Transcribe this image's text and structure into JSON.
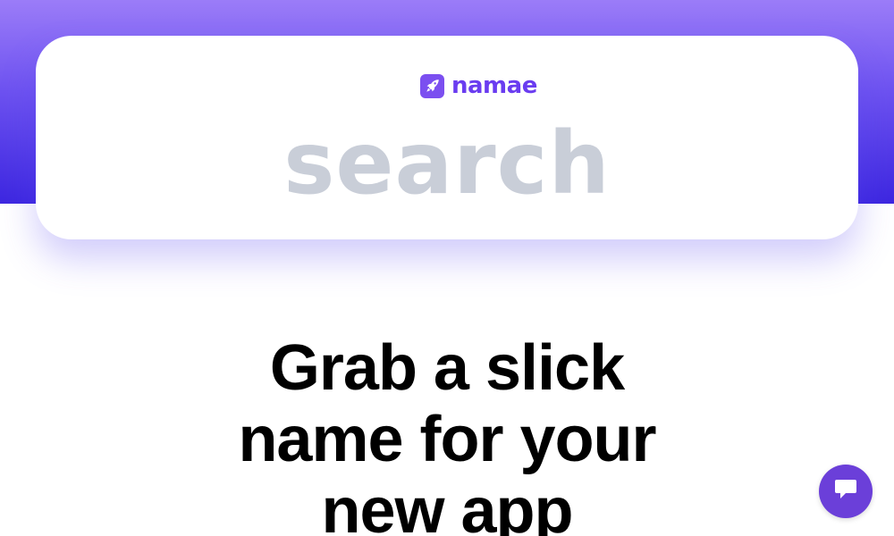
{
  "brand": {
    "name": "namae",
    "logo_icon": "rocket-icon",
    "color": "#6a3cf0"
  },
  "search": {
    "placeholder": "search",
    "value": ""
  },
  "hero": {
    "headline_lines": [
      "Grab a slick",
      "name for your",
      "new app"
    ]
  },
  "chat": {
    "icon": "chat-bubble-icon",
    "color": "#6b3fd9"
  },
  "colors": {
    "gradient_top": "#9b7cf8",
    "gradient_bottom": "#3d27e0",
    "placeholder": "#c9ced8"
  }
}
